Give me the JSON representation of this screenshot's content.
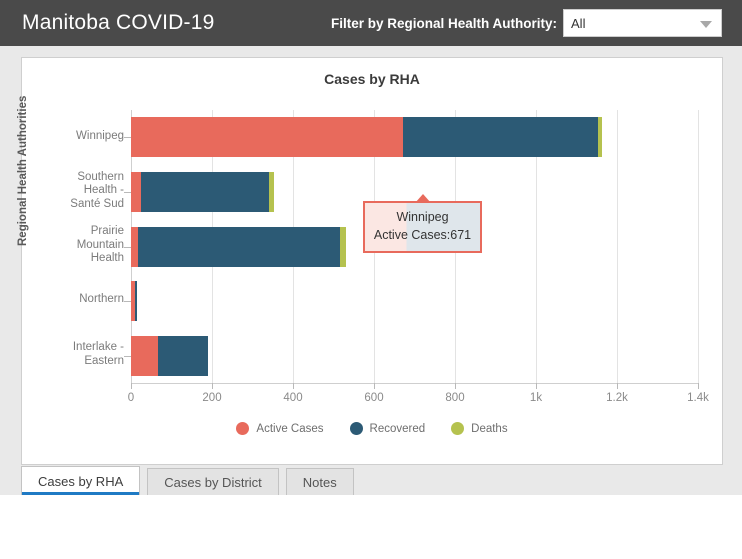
{
  "header": {
    "app_title": "Manitoba COVID-19",
    "filter_label": "Filter by Regional Health Authority:",
    "filter_value": "All",
    "caret_icon": "chevron-down-icon"
  },
  "chart_panel": {
    "title": "Cases by RHA"
  },
  "tooltip": {
    "title": "Winnipeg",
    "detail": "Active Cases:671"
  },
  "tabs": [
    {
      "label": "Cases by RHA",
      "active": true
    },
    {
      "label": "Cases by District",
      "active": false
    },
    {
      "label": "Notes",
      "active": false
    }
  ],
  "chart_data": {
    "type": "bar",
    "orientation": "horizontal",
    "stacked": true,
    "title": "Cases by RHA",
    "xlabel": "",
    "ylabel": "Regional Health Authorities",
    "categories": [
      "Winnipeg",
      "Southern Health - Santé Sud",
      "Prairie Mountain Health",
      "Northern",
      "Interlake - Eastern"
    ],
    "category_lines": [
      [
        "Winnipeg"
      ],
      [
        "Southern",
        "Health -",
        "Santé Sud"
      ],
      [
        "Prairie",
        "Mountain",
        "Health"
      ],
      [
        "Northern"
      ],
      [
        "Interlake -",
        "Eastern"
      ]
    ],
    "series": [
      {
        "name": "Active Cases",
        "color": "#e86a5c",
        "values": [
          671,
          25,
          18,
          10,
          67
        ]
      },
      {
        "name": "Recovered",
        "color": "#2c5a75",
        "values": [
          481,
          315,
          498,
          5,
          123
        ]
      },
      {
        "name": "Deaths",
        "color": "#b5c24f",
        "values": [
          12,
          12,
          15,
          0,
          0
        ]
      }
    ],
    "xlim": [
      0,
      1400
    ],
    "xticks": [
      0,
      200,
      400,
      600,
      800,
      1000,
      1200,
      1400
    ],
    "xtick_labels": [
      "0",
      "200",
      "400",
      "600",
      "800",
      "1k",
      "1.2k",
      "1.4k"
    ],
    "grid": true,
    "legend_position": "bottom"
  }
}
